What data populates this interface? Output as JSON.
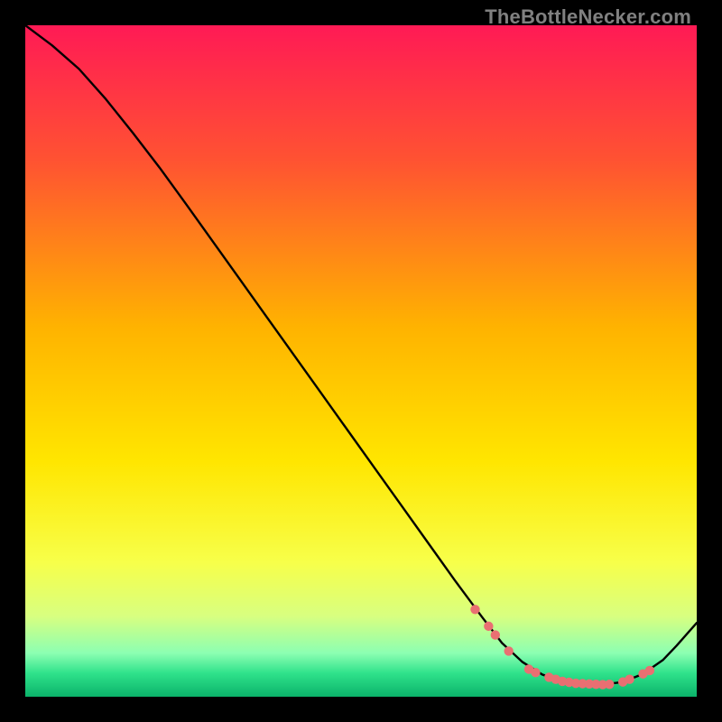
{
  "watermark": "TheBottleNecker.com",
  "chart_data": {
    "type": "line",
    "title": "",
    "xlabel": "",
    "ylabel": "",
    "xlim": [
      0,
      100
    ],
    "ylim": [
      0,
      100
    ],
    "gradient_stops": [
      {
        "offset": 0.0,
        "color": "#ff1a55"
      },
      {
        "offset": 0.2,
        "color": "#ff5232"
      },
      {
        "offset": 0.45,
        "color": "#ffb300"
      },
      {
        "offset": 0.65,
        "color": "#ffe600"
      },
      {
        "offset": 0.8,
        "color": "#f7ff4a"
      },
      {
        "offset": 0.88,
        "color": "#d8ff80"
      },
      {
        "offset": 0.935,
        "color": "#8cffb2"
      },
      {
        "offset": 0.965,
        "color": "#2fe28b"
      },
      {
        "offset": 1.0,
        "color": "#0bb36a"
      }
    ],
    "series": [
      {
        "name": "bottleneck-curve",
        "x": [
          0,
          4,
          8,
          12,
          16,
          20,
          24,
          28,
          32,
          36,
          40,
          44,
          48,
          52,
          56,
          60,
          64,
          68,
          71,
          74,
          77,
          80,
          83,
          86,
          89,
          92,
          95,
          97,
          100
        ],
        "y": [
          100,
          97,
          93.5,
          89,
          84,
          78.8,
          73.3,
          67.7,
          62.1,
          56.5,
          50.9,
          45.3,
          39.7,
          34.1,
          28.5,
          22.9,
          17.3,
          11.9,
          8.0,
          5.2,
          3.3,
          2.3,
          1.9,
          1.8,
          2.2,
          3.4,
          5.5,
          7.6,
          11.0
        ]
      }
    ],
    "markers": {
      "name": "sample-points",
      "color": "#e96f72",
      "x": [
        67,
        69,
        70,
        72,
        75,
        76,
        78,
        79,
        80,
        81,
        82,
        83,
        84,
        85,
        86,
        87,
        89,
        90,
        92,
        93
      ],
      "y": [
        13.0,
        10.5,
        9.2,
        6.8,
        4.1,
        3.6,
        2.9,
        2.6,
        2.3,
        2.15,
        2.0,
        1.95,
        1.9,
        1.85,
        1.8,
        1.85,
        2.2,
        2.6,
        3.4,
        3.9
      ]
    }
  }
}
